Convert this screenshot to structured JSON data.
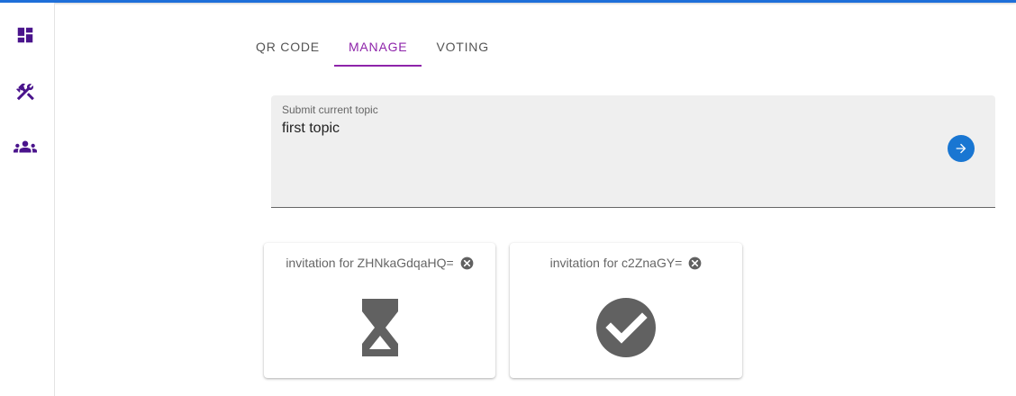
{
  "colors": {
    "accent": "#8e24aa",
    "primary": "#1976d2",
    "icon_gray": "#616161"
  },
  "sidebar": {
    "items": [
      {
        "icon": "dashboard-icon"
      },
      {
        "icon": "tools-icon"
      },
      {
        "icon": "groups-icon"
      }
    ]
  },
  "tabs": [
    {
      "label": "QR CODE",
      "active": false
    },
    {
      "label": "MANAGE",
      "active": true
    },
    {
      "label": "VOTING",
      "active": false
    }
  ],
  "topic": {
    "label": "Submit current topic",
    "value": "first topic",
    "submit_icon": "arrow-right-icon"
  },
  "invitations": [
    {
      "title": "invitation for ZHNkaGdqaHQ=",
      "status": "pending",
      "status_icon": "hourglass-icon",
      "close_icon": "cancel-icon"
    },
    {
      "title": "invitation for c2ZnaGY=",
      "status": "accepted",
      "status_icon": "check-circle-icon",
      "close_icon": "cancel-icon"
    }
  ]
}
